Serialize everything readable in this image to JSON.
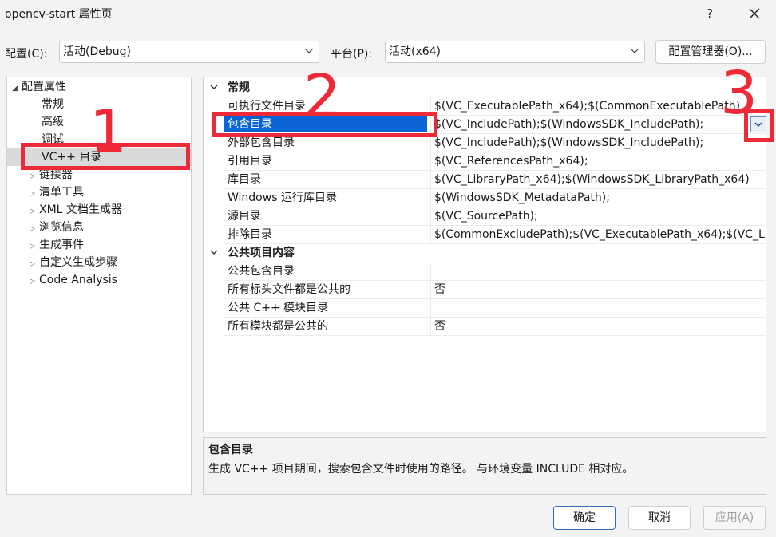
{
  "window": {
    "title": "opencv-start 属性页",
    "help_label": "?"
  },
  "toolbar": {
    "config_label": "配置(C):",
    "config_value": "活动(Debug)",
    "platform_label": "平台(P):",
    "platform_value": "活动(x64)",
    "config_manager_label": "配置管理器(O)..."
  },
  "tree": {
    "root": "配置属性",
    "items": [
      {
        "label": "常规",
        "expandable": false
      },
      {
        "label": "高级",
        "expandable": false
      },
      {
        "label": "调试",
        "expandable": false
      },
      {
        "label": "VC++ 目录",
        "expandable": false,
        "selected": true
      },
      {
        "label": "链接器",
        "expandable": true
      },
      {
        "label": "清单工具",
        "expandable": true
      },
      {
        "label": "XML 文档生成器",
        "expandable": true
      },
      {
        "label": "浏览信息",
        "expandable": true
      },
      {
        "label": "生成事件",
        "expandable": true
      },
      {
        "label": "自定义生成步骤",
        "expandable": true
      },
      {
        "label": "Code Analysis",
        "expandable": true
      }
    ]
  },
  "grid": {
    "categories": [
      {
        "name": "常规",
        "rows": [
          {
            "name": "可执行文件目录",
            "value": "$(VC_ExecutablePath_x64);$(CommonExecutablePath)"
          },
          {
            "name": "包含目录",
            "value": "$(VC_IncludePath);$(WindowsSDK_IncludePath);",
            "selected": true
          },
          {
            "name": "外部包含目录",
            "value": "$(VC_IncludePath);$(WindowsSDK_IncludePath);"
          },
          {
            "name": "引用目录",
            "value": "$(VC_ReferencesPath_x64);"
          },
          {
            "name": "库目录",
            "value": "$(VC_LibraryPath_x64);$(WindowsSDK_LibraryPath_x64)"
          },
          {
            "name": "Windows 运行库目录",
            "value": "$(WindowsSDK_MetadataPath);"
          },
          {
            "name": "源目录",
            "value": "$(VC_SourcePath);"
          },
          {
            "name": "排除目录",
            "value": "$(CommonExcludePath);$(VC_ExecutablePath_x64);$(VC_Li"
          }
        ]
      },
      {
        "name": "公共项目内容",
        "rows": [
          {
            "name": "公共包含目录",
            "value": ""
          },
          {
            "name": "所有标头文件都是公共的",
            "value": "否"
          },
          {
            "name": "公共 C++ 模块目录",
            "value": ""
          },
          {
            "name": "所有模块都是公共的",
            "value": "否"
          }
        ]
      }
    ]
  },
  "description": {
    "title": "包含目录",
    "text": "生成 VC++ 项目期间，搜索包含文件时使用的路径。 与环境变量 INCLUDE 相对应。"
  },
  "buttons": {
    "ok": "确定",
    "cancel": "取消",
    "apply": "应用(A)"
  },
  "annotations": [
    "1",
    "2",
    "3"
  ],
  "colors": {
    "annotation": "#ee2a38",
    "selection": "#0a64d6"
  }
}
